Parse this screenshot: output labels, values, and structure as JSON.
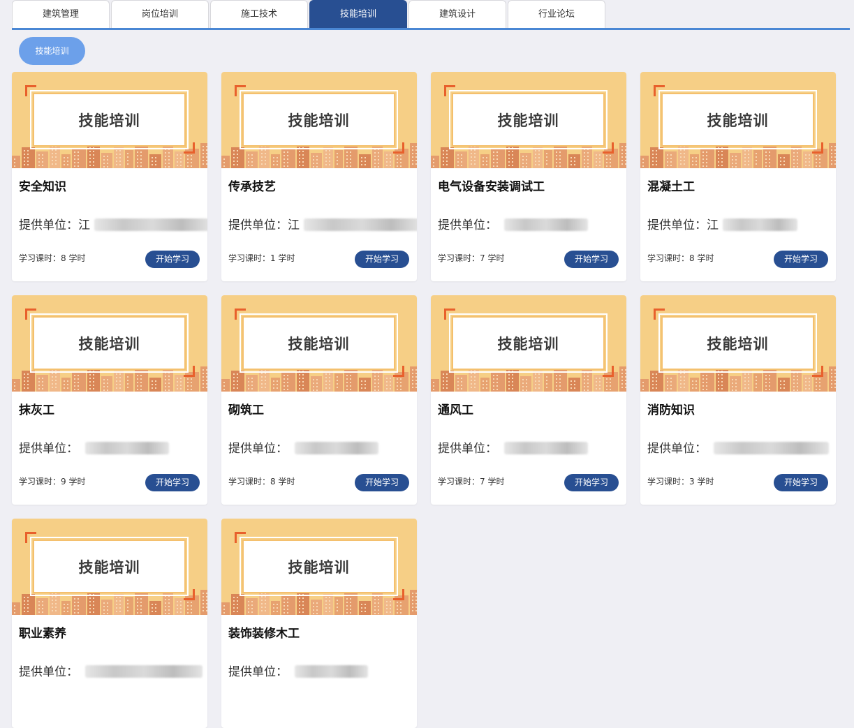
{
  "tabs": [
    {
      "label": "建筑管理",
      "active": false
    },
    {
      "label": "岗位培训",
      "active": false
    },
    {
      "label": "施工技术",
      "active": false
    },
    {
      "label": "技能培训",
      "active": true
    },
    {
      "label": "建筑设计",
      "active": false
    },
    {
      "label": "行业论坛",
      "active": false
    }
  ],
  "filter": {
    "label": "技能培训"
  },
  "course_common": {
    "banner_text": "技能培训",
    "provider_label": "提供单位：",
    "start_button": "开始学习"
  },
  "courses": [
    {
      "title": "安全知识",
      "provider_visible": "提供单位：江",
      "hours": "学习课时：8 学时"
    },
    {
      "title": "传承技艺",
      "provider_visible": "提供单位：江",
      "hours": "学习课时：1 学时"
    },
    {
      "title": "电气设备安装调试工",
      "provider_visible": "提供单位：",
      "hours": "学习课时：7 学时"
    },
    {
      "title": "混凝土工",
      "provider_visible": "提供单位：江",
      "hours": "学习课时：8 学时"
    },
    {
      "title": "抹灰工",
      "provider_visible": "提供单位：",
      "hours": "学习课时：9 学时"
    },
    {
      "title": "砌筑工",
      "provider_visible": "提供单位：",
      "hours": "学习课时：8 学时"
    },
    {
      "title": "通风工",
      "provider_visible": "提供单位：",
      "hours": "学习课时：7 学时"
    },
    {
      "title": "消防知识",
      "provider_visible": "提供单位：",
      "hours": "学习课时：3 学时"
    },
    {
      "title": "职业素养",
      "provider_visible": "提供单位：",
      "hours": ""
    },
    {
      "title": "装饰装修木工",
      "provider_visible": "提供单位：",
      "hours": ""
    }
  ],
  "colors": {
    "accent": "#284f92",
    "tab_underline": "#4a87d4",
    "filter_pill": "#6ca0ea",
    "banner_bg": "#f6cf86",
    "banner_corner": "#e8602c",
    "page_bg": "#efeff4"
  }
}
